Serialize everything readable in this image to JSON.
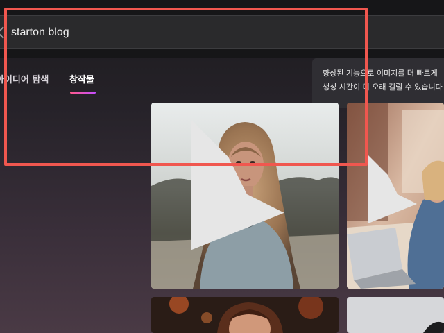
{
  "search": {
    "value": "starton blog"
  },
  "tabs": [
    {
      "label": "아이디어 탐색"
    },
    {
      "label": "창작물"
    }
  ],
  "tooltip": {
    "line1": "향상된 기능으로 이미지를 더 빠르게",
    "line2": "생성 시간이 더 오래 걸릴 수 있습니다"
  },
  "colors": {
    "accent_gradient_start": "#ff5a8a",
    "accent_gradient_end": "#c44dff",
    "highlight_box": "#f0574f"
  },
  "icons": {
    "back": "chevron-left-icon",
    "card_mark": "bing-mark-icon"
  }
}
